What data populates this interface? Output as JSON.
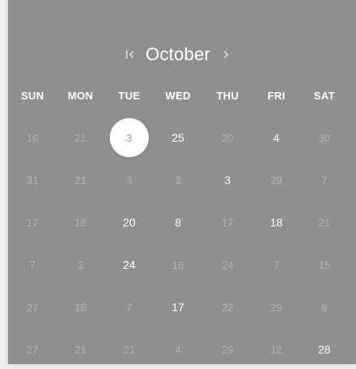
{
  "calendar": {
    "month": "October",
    "prev_icon": "first-page-icon",
    "next_icon": "chevron-right-icon",
    "weekdays": [
      "SUN",
      "MON",
      "TUE",
      "WED",
      "THU",
      "FRI",
      "SAT"
    ],
    "weeks": [
      [
        {
          "label": "16",
          "state": "dim"
        },
        {
          "label": "21",
          "state": "dim"
        },
        {
          "label": "3",
          "state": "selected"
        },
        {
          "label": "25",
          "state": "bright"
        },
        {
          "label": "20",
          "state": "dim"
        },
        {
          "label": "4",
          "state": "bright"
        },
        {
          "label": "30",
          "state": "dim"
        }
      ],
      [
        {
          "label": "31",
          "state": "dim"
        },
        {
          "label": "21",
          "state": "dim"
        },
        {
          "label": "3",
          "state": "dim"
        },
        {
          "label": "3",
          "state": "dim"
        },
        {
          "label": "3",
          "state": "bright"
        },
        {
          "label": "29",
          "state": "dim"
        },
        {
          "label": "7",
          "state": "dim"
        }
      ],
      [
        {
          "label": "17",
          "state": "dim"
        },
        {
          "label": "18",
          "state": "dim"
        },
        {
          "label": "20",
          "state": "bright"
        },
        {
          "label": "8",
          "state": "bright"
        },
        {
          "label": "17",
          "state": "dim"
        },
        {
          "label": "18",
          "state": "bright"
        },
        {
          "label": "21",
          "state": "dim"
        }
      ],
      [
        {
          "label": "7",
          "state": "dim"
        },
        {
          "label": "3",
          "state": "dim"
        },
        {
          "label": "24",
          "state": "bright"
        },
        {
          "label": "16",
          "state": "dim"
        },
        {
          "label": "24",
          "state": "dim"
        },
        {
          "label": "7",
          "state": "dim"
        },
        {
          "label": "15",
          "state": "dim"
        }
      ],
      [
        {
          "label": "27",
          "state": "dim"
        },
        {
          "label": "18",
          "state": "dim"
        },
        {
          "label": "7",
          "state": "dim"
        },
        {
          "label": "17",
          "state": "bright"
        },
        {
          "label": "22",
          "state": "dim"
        },
        {
          "label": "29",
          "state": "dim"
        },
        {
          "label": "6",
          "state": "dim"
        }
      ],
      [
        {
          "label": "27",
          "state": "dim"
        },
        {
          "label": "21",
          "state": "dim"
        },
        {
          "label": "21",
          "state": "dim"
        },
        {
          "label": "4",
          "state": "dim"
        },
        {
          "label": "29",
          "state": "dim"
        },
        {
          "label": "12",
          "state": "dim"
        },
        {
          "label": "28",
          "state": "bright"
        }
      ]
    ]
  },
  "colors": {
    "panel_bg": "#8f8f8f",
    "text": "#ffffff",
    "selected_bg": "#ffffff",
    "selected_text": "#9a9a9a"
  }
}
